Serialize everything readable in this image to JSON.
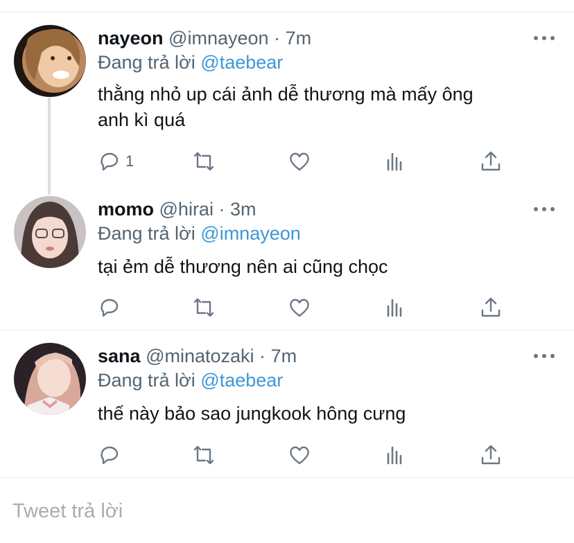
{
  "tweets": [
    {
      "name": "nayeon",
      "handle": "@imnayeon",
      "time": "7m",
      "reply_prefix": "Đang trả lời",
      "reply_to": "@taebear",
      "text_line1": "thằng nhỏ up cái ảnh dễ thương mà mấy ông",
      "text_line2": "anh kì quá",
      "reply_count": "1"
    },
    {
      "name": "momo",
      "handle": "@hirai",
      "time": "3m",
      "reply_prefix": "Đang trả lời",
      "reply_to": "@imnayeon",
      "text_line1": "tại ẻm dễ thương nên ai cũng chọc",
      "reply_count": ""
    },
    {
      "name": "sana",
      "handle": "@minatozaki",
      "time": "7m",
      "reply_prefix": "Đang trả lời",
      "reply_to": "@taebear",
      "text_line1": "thế này bảo sao jungkook hông cưng",
      "reply_count": ""
    }
  ],
  "separator": "·",
  "reply_input": {
    "placeholder": "Tweet trả lời"
  },
  "icons": [
    "reply-icon",
    "retweet-icon",
    "like-icon",
    "analytics-icon",
    "share-icon",
    "more-icon"
  ],
  "colors": {
    "mention": "#3c97d8",
    "muted": "#536471",
    "icon": "#6b7785",
    "divider": "#e6ecf0"
  }
}
